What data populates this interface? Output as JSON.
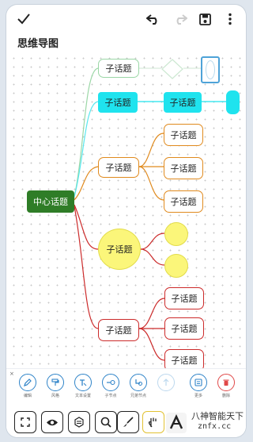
{
  "app_title": "思维导图",
  "toolbar": {
    "confirm_icon": "check-icon",
    "undo_icon": "undo-icon",
    "redo_icon": "redo-icon",
    "save_icon": "save-icon",
    "more_icon": "more-vertical-icon"
  },
  "mindmap": {
    "center_label": "中心话题",
    "branch1_label": "子话题",
    "branch2_label": "子话题",
    "branch2_child_label": "子话题",
    "branch3_label": "子话题",
    "branch3_children": [
      "子话题",
      "子话题",
      "子话题"
    ],
    "branch4_label": "子话题",
    "branch5_label": "子话题",
    "branch5_children": [
      "子话题",
      "子话题",
      "子话题"
    ]
  },
  "bottom_toolbar": {
    "close_label": "×",
    "items": [
      {
        "label": "编辑",
        "icon": "pencil-icon"
      },
      {
        "label": "风格",
        "icon": "paint-roller-icon"
      },
      {
        "label": "文本设置",
        "icon": "text-format-icon"
      },
      {
        "label": "子节点",
        "icon": "add-child-node-icon"
      },
      {
        "label": "兄弟节点",
        "icon": "add-sibling-node-icon"
      },
      {
        "label": "",
        "icon": "arrow-up-icon"
      },
      {
        "label": "更多",
        "icon": "more-grid-icon"
      },
      {
        "label": "删除",
        "icon": "trash-icon"
      }
    ]
  },
  "bottom_actions": [
    "fullscreen-icon",
    "eye-icon",
    "layout-icon",
    "zoom-search-icon",
    "brush-icon",
    "hand-icon"
  ],
  "watermark": {
    "title": "八神智能天下",
    "url": "znfx.cc"
  },
  "colors": {
    "center": "#2f7d27",
    "cyan": "#1fe3ee",
    "orange": "#e08a1e",
    "red": "#cc2b2b",
    "yellow": "#fbf67a",
    "accent_blue": "#2e83c8"
  }
}
